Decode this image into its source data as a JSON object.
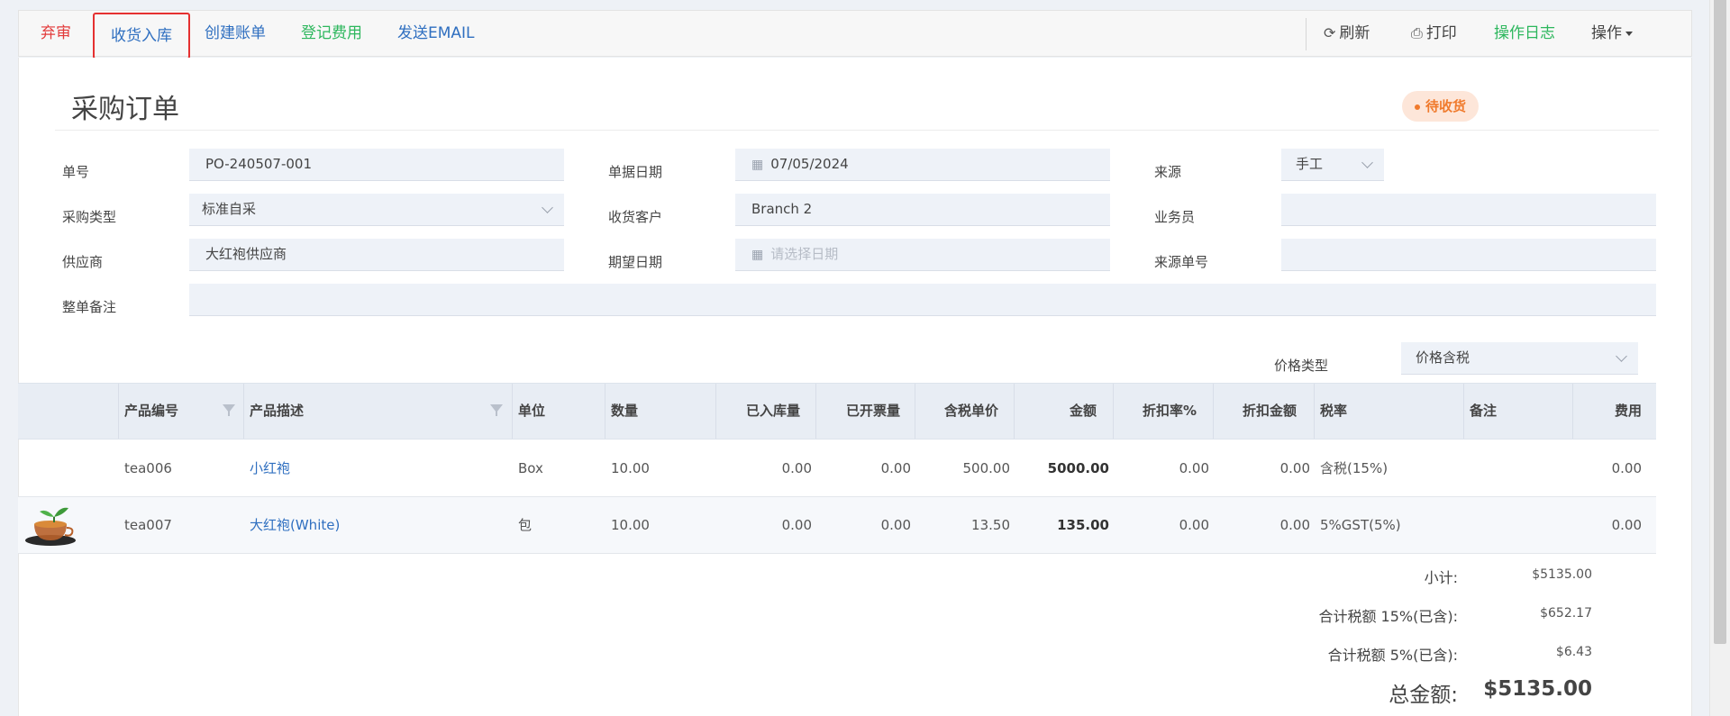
{
  "toolbar": {
    "abandon": "弃审",
    "receive": "收货入库",
    "create_bill": "创建账单",
    "register_fee": "登记费用",
    "send_email": "发送EMAIL",
    "refresh": "刷新",
    "print": "打印",
    "op_log": "操作日志",
    "actions": "操作"
  },
  "page": {
    "title": "采购订单"
  },
  "form": {
    "order_no_label": "单号",
    "order_no": "PO-240507-001",
    "doc_date_label": "单据日期",
    "doc_date": "07/05/2024",
    "source_label": "来源",
    "source": "手工",
    "status": "待收货",
    "purchase_type_label": "采购类型",
    "purchase_type": "标准自采",
    "customer_label": "收货客户",
    "customer": "Branch 2",
    "salesman_label": "业务员",
    "salesman": "",
    "supplier_label": "供应商",
    "supplier": "大红袍供应商",
    "expected_date_label": "期望日期",
    "expected_date_placeholder": "请选择日期",
    "source_no_label": "来源单号",
    "source_no": "",
    "remark_label": "整单备注",
    "remark": ""
  },
  "price_type": {
    "label": "价格类型",
    "value": "价格含税"
  },
  "table": {
    "headers": {
      "code": "产品编号",
      "desc": "产品描述",
      "unit": "单位",
      "qty": "数量",
      "received": "已入库量",
      "invoiced": "已开票量",
      "price": "含税单价",
      "amount": "金额",
      "discount_rate": "折扣率%",
      "discount_amount": "折扣金额",
      "tax_rate": "税率",
      "remark": "备注",
      "fee": "费用"
    },
    "rows": [
      {
        "code": "tea006",
        "desc": "小红袍",
        "unit": "Box",
        "qty": "10.00",
        "received": "0.00",
        "invoiced": "0.00",
        "price": "500.00",
        "amount": "5000.00",
        "discount_rate": "0.00",
        "discount_amount": "0.00",
        "tax_rate": "含税(15%)",
        "remark": "",
        "fee": "0.00"
      },
      {
        "code": "tea007",
        "desc": "大红袍(White)",
        "unit": "包",
        "qty": "10.00",
        "received": "0.00",
        "invoiced": "0.00",
        "price": "13.50",
        "amount": "135.00",
        "discount_rate": "0.00",
        "discount_amount": "0.00",
        "tax_rate": "5%GST(5%)",
        "remark": "",
        "fee": "0.00"
      }
    ]
  },
  "totals": {
    "subtotal_label": "小计:",
    "subtotal": "$5135.00",
    "tax15_label": "合计税额 15%(已含):",
    "tax15": "$652.17",
    "tax5_label": "合计税额 5%(已含):",
    "tax5": "$6.43",
    "grand_label": "总金额:",
    "grand": "$5135.00"
  }
}
